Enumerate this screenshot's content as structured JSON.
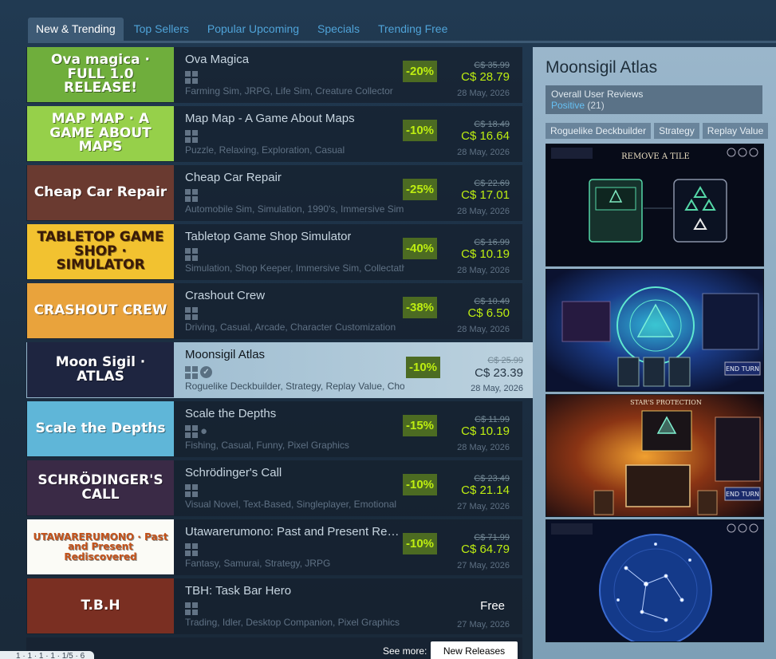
{
  "tabs": [
    "New & Trending",
    "Top Sellers",
    "Popular Upcoming",
    "Specials",
    "Trending Free"
  ],
  "games": [
    {
      "name": "Ova Magica",
      "thumb_text": "Ova magica · FULL 1.0 RELEASE!",
      "tags": "Farming Sim, JRPG, Life Sim, Creature Collector",
      "discount": "-20%",
      "original": "C$ 35.99",
      "final": "C$ 28.79",
      "date": "28 May, 2026",
      "thumb_bg": "#6fae3c"
    },
    {
      "name": "Map Map - A Game About Maps",
      "thumb_text": "MAP MAP · A GAME ABOUT MAPS",
      "tags": "Puzzle, Relaxing, Exploration, Casual",
      "discount": "-10%",
      "original": "C$ 18.49",
      "final": "C$ 16.64",
      "date": "28 May, 2026",
      "thumb_bg": "#96d04a"
    },
    {
      "name": "Cheap Car Repair",
      "thumb_text": "Cheap Car Repair",
      "tags": "Automobile Sim, Simulation, 1990's, Immersive Sim",
      "discount": "-25%",
      "original": "C$ 22.69",
      "final": "C$ 17.01",
      "date": "28 May, 2026",
      "thumb_bg": "#6a3a30"
    },
    {
      "name": "Tabletop Game Shop Simulator",
      "thumb_text": "TABLETOP GAME SHOP · SIMULATOR",
      "tags": "Simulation, Shop Keeper, Immersive Sim, Collectathon",
      "discount": "-40%",
      "original": "C$ 16.99",
      "final": "C$ 10.19",
      "date": "28 May, 2026",
      "thumb_bg": "#f2c230"
    },
    {
      "name": "Crashout Crew",
      "thumb_text": "CRASHOUT CREW",
      "tags": "Driving, Casual, Arcade, Character Customization",
      "discount": "-38%",
      "original": "C$ 10.49",
      "final": "C$ 6.50",
      "date": "28 May, 2026",
      "thumb_bg": "#e9a33c"
    },
    {
      "name": "Moonsigil Atlas",
      "thumb_text": "Moon Sigil · ATLAS",
      "tags": "Roguelike Deckbuilder, Strategy, Replay Value, Choices Matter",
      "discount": "-10%",
      "original": "C$ 25.99",
      "final": "C$ 23.39",
      "date": "28 May, 2026",
      "thumb_bg": "#1e2540"
    },
    {
      "name": "Scale the Depths",
      "thumb_text": "Scale the Depths",
      "tags": "Fishing, Casual, Funny, Pixel Graphics",
      "discount": "-15%",
      "original": "C$ 11.99",
      "final": "C$ 10.19",
      "date": "28 May, 2026",
      "thumb_bg": "#5fb6d8"
    },
    {
      "name": "Schrödinger's Call",
      "thumb_text": "SCHRÖDINGER'S CALL",
      "tags": "Visual Novel, Text-Based, Singleplayer, Emotional",
      "discount": "-10%",
      "original": "C$ 23.49",
      "final": "C$ 21.14",
      "date": "27 May, 2026",
      "thumb_bg": "#3a2a46"
    },
    {
      "name": "Utawarerumono: Past and Present Rediscovered",
      "thumb_text": "UTAWARERUMONO · Past and Present Rediscovered",
      "tags": "Fantasy, Samurai, Strategy, JRPG",
      "discount": "-10%",
      "original": "C$ 71.99",
      "final": "C$ 64.79",
      "date": "27 May, 2026",
      "thumb_bg": "#fbfbf6"
    },
    {
      "name": "TBH: Task Bar Hero",
      "thumb_text": "T.B.H",
      "tags": "Trading, Idler, Desktop Companion, Pixel Graphics",
      "discount": "",
      "original": "",
      "final": "Free",
      "date": "27 May, 2026",
      "thumb_bg": "#7a2f22"
    }
  ],
  "see_more": {
    "label": "See more:",
    "button": "New Releases"
  },
  "corner_chip": "1 · 1 · 1 · 1 · 1/5 · 6",
  "preview": {
    "title": "Moonsigil Atlas",
    "reviews_label": "Overall User Reviews",
    "reviews_value": "Positive",
    "reviews_count": "(21)",
    "tags": [
      "Roguelike Deckbuilder",
      "Strategy",
      "Replay Value"
    ],
    "screenshots": [
      {
        "caption": "REMOVE A TILE",
        "bg": "#0b1020"
      },
      {
        "caption": "END TURN",
        "bg": "#10204a"
      },
      {
        "caption": "STAR'S PROTECTION",
        "bg": "#3a1a16"
      },
      {
        "caption": "",
        "bg": "#0a1636"
      }
    ]
  },
  "colors": {
    "accent_blue": "#66c0f4",
    "discount_bg": "#4c6b22",
    "discount_text": "#beee11"
  }
}
